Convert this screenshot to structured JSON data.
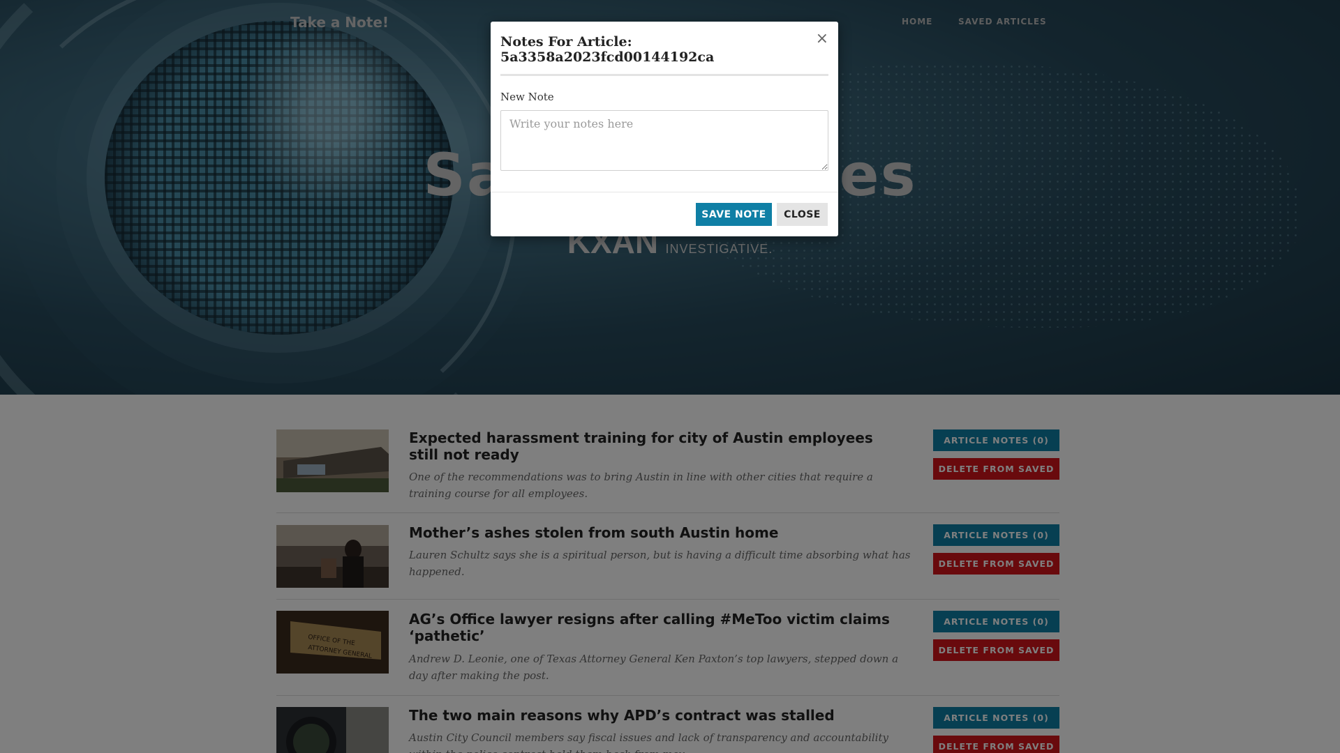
{
  "nav": {
    "brand": "Take a Note!",
    "links": [
      "HOME",
      "SAVED ARTICLES"
    ]
  },
  "hero": {
    "title": "Saved Articles",
    "logo_mark": "KXAN",
    "logo_sub": "INVESTIGATIVE."
  },
  "articles": [
    {
      "title": "Expected harassment training for city of Austin employees still not ready",
      "description": "One of the recommendations was to bring Austin in line with other cities that require a training course for all employees.",
      "notes_label": "ARTICLE NOTES (0)",
      "delete_label": "DELETE FROM SAVED"
    },
    {
      "title": "Mother’s ashes stolen from south Austin home",
      "description": "Lauren Schultz says she is a spiritual person, but is having a difficult time absorbing what has happened.",
      "notes_label": "ARTICLE NOTES (0)",
      "delete_label": "DELETE FROM SAVED"
    },
    {
      "title": "AG’s Office lawyer resigns after calling #MeToo victim claims ‘pathetic’",
      "description": "Andrew D. Leonie, one of Texas Attorney General Ken Paxton’s top lawyers, stepped down a day after making the post.",
      "notes_label": "ARTICLE NOTES (0)",
      "delete_label": "DELETE FROM SAVED"
    },
    {
      "title": "The two main reasons why APD’s contract was stalled",
      "description": "Austin City Council members say fiscal issues and lack of transparency and accountability within the police contract held them back from mov",
      "notes_label": "ARTICLE NOTES (0)",
      "delete_label": "DELETE FROM SAVED"
    }
  ],
  "modal": {
    "title": "Notes For Article: 5a3358a2023fcd00144192ca",
    "close_glyph": "×",
    "field_label": "New Note",
    "placeholder": "Write your notes here",
    "save_label": "SAVE NOTE",
    "close_label": "CLOSE"
  },
  "colors": {
    "primary": "#0f7fa5",
    "danger": "#d3141b",
    "overlay": "rgba(0,0,0,0.5)"
  }
}
